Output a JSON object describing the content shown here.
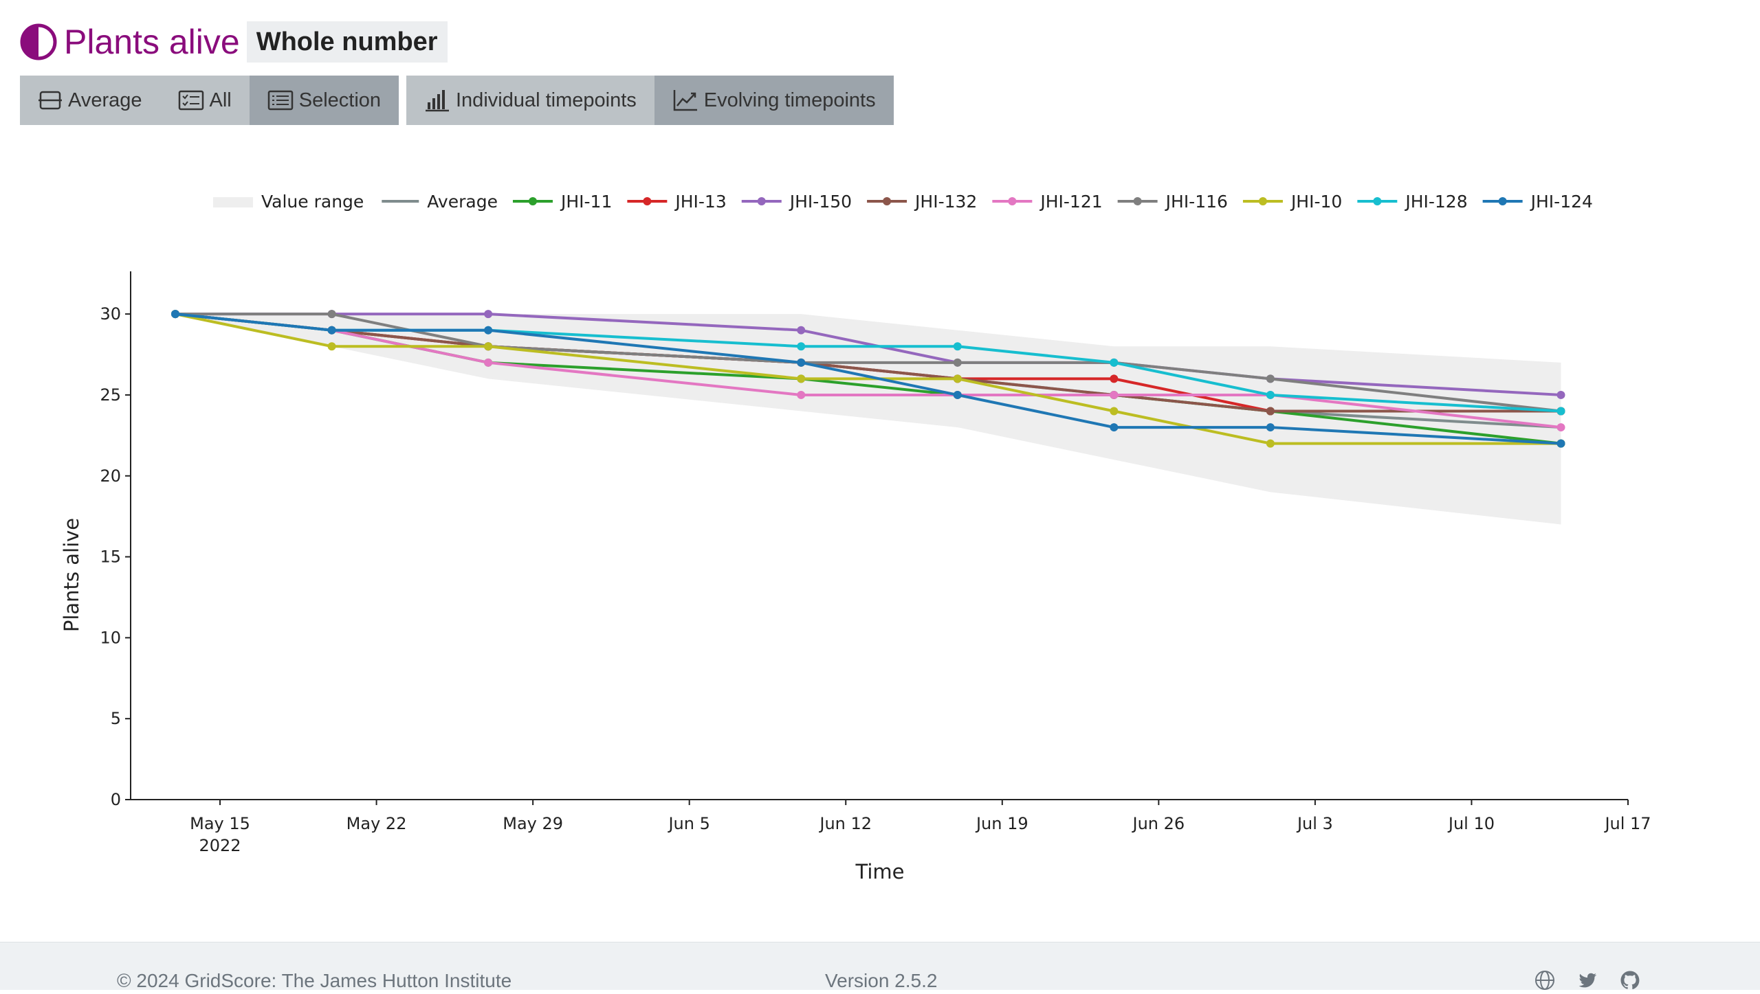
{
  "header": {
    "title": "Plants alive",
    "data_type": "Whole number",
    "accent_color": "#8a0c7c"
  },
  "toolbar": {
    "view_buttons": [
      {
        "label": "Average",
        "icon": "average-icon",
        "active": false
      },
      {
        "label": "All",
        "icon": "all-list-icon",
        "active": false
      },
      {
        "label": "Selection",
        "icon": "selection-list-icon",
        "active": true
      }
    ],
    "mode_buttons": [
      {
        "label": "Individual timepoints",
        "icon": "bar-chart-icon",
        "active": false
      },
      {
        "label": "Evolving timepoints",
        "icon": "line-chart-icon",
        "active": true
      }
    ]
  },
  "chart_data": {
    "type": "line",
    "title": "",
    "xlabel": "Time",
    "ylabel": "Plants alive",
    "ylim": [
      0,
      32
    ],
    "xlim": [
      "2022-05-11",
      "2022-07-17"
    ],
    "yticks": [
      0,
      5,
      10,
      15,
      20,
      25,
      30
    ],
    "xticks": [
      {
        "date": "2022-05-15",
        "label": "May 15",
        "sublabel": "2022"
      },
      {
        "date": "2022-05-22",
        "label": "May 22"
      },
      {
        "date": "2022-05-29",
        "label": "May 29"
      },
      {
        "date": "2022-06-05",
        "label": "Jun 5"
      },
      {
        "date": "2022-06-12",
        "label": "Jun 12"
      },
      {
        "date": "2022-06-19",
        "label": "Jun 19"
      },
      {
        "date": "2022-06-26",
        "label": "Jun 26"
      },
      {
        "date": "2022-07-03",
        "label": "Jul 3"
      },
      {
        "date": "2022-07-10",
        "label": "Jul 10"
      },
      {
        "date": "2022-07-17",
        "label": "Jul 17"
      }
    ],
    "grid": false,
    "legend_position": "top",
    "x": [
      "2022-05-13",
      "2022-05-20",
      "2022-05-27",
      "2022-06-10",
      "2022-06-17",
      "2022-06-24",
      "2022-07-01",
      "2022-07-14"
    ],
    "range": {
      "name": "Value range",
      "color": "#eeeeee",
      "min": [
        30,
        28,
        26,
        24,
        23,
        21,
        19,
        17
      ],
      "max": [
        30,
        30,
        30,
        30,
        29,
        28,
        28,
        27
      ]
    },
    "average": {
      "name": "Average",
      "color": "#7f8c8d",
      "values": [
        30,
        29,
        28,
        27,
        26,
        25,
        24,
        23
      ]
    },
    "series": [
      {
        "name": "JHI-11",
        "color": "#2ca02c",
        "values": [
          30,
          29,
          27,
          26,
          25,
          25,
          24,
          22
        ]
      },
      {
        "name": "JHI-13",
        "color": "#d62728",
        "values": [
          30,
          29,
          28,
          27,
          26,
          26,
          24,
          24
        ]
      },
      {
        "name": "JHI-150",
        "color": "#9467bd",
        "values": [
          30,
          30,
          30,
          29,
          27,
          27,
          26,
          25
        ]
      },
      {
        "name": "JHI-132",
        "color": "#8c564b",
        "values": [
          30,
          29,
          28,
          27,
          26,
          25,
          24,
          24
        ]
      },
      {
        "name": "JHI-121",
        "color": "#e377c2",
        "values": [
          30,
          29,
          27,
          25,
          25,
          25,
          25,
          23
        ]
      },
      {
        "name": "JHI-116",
        "color": "#7f7f7f",
        "values": [
          30,
          30,
          28,
          27,
          27,
          27,
          26,
          24
        ]
      },
      {
        "name": "JHI-10",
        "color": "#bcbd22",
        "values": [
          30,
          28,
          28,
          26,
          26,
          24,
          22,
          22
        ]
      },
      {
        "name": "JHI-128",
        "color": "#17becf",
        "values": [
          30,
          29,
          29,
          28,
          28,
          27,
          25,
          24
        ]
      },
      {
        "name": "JHI-124",
        "color": "#1f77b4",
        "values": [
          30,
          29,
          29,
          27,
          25,
          23,
          23,
          22
        ]
      }
    ]
  },
  "footer": {
    "copyright": "© 2024 GridScore: The James Hutton Institute",
    "version": "Version 2.5.2",
    "icons": [
      "globe-icon",
      "twitter-icon",
      "github-icon"
    ]
  }
}
